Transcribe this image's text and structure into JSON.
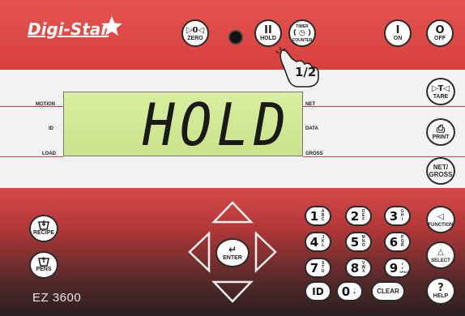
{
  "brand": {
    "logo": "Digi-Star"
  },
  "model": "EZ 3600",
  "display": {
    "text": "HOLD",
    "annotations_left": [
      "MOTION",
      "ID",
      "LOAD"
    ],
    "annotations_right": [
      "NET",
      "DATA",
      "GROSS"
    ]
  },
  "top_buttons": {
    "zero": {
      "symbol": "▷0◁",
      "label": "ZERO"
    },
    "hold": {
      "symbol": "II",
      "label": "HOLD"
    },
    "timer_top": "TIMER",
    "timer_symbol": "( ◷ )",
    "timer_bottom": "COUNTER",
    "on": {
      "symbol": "I",
      "label": "ON"
    },
    "off": {
      "symbol": "O",
      "label": "OFF"
    }
  },
  "hand_callout": "1/2",
  "right_buttons": {
    "tare": {
      "symbol": "▷T◁",
      "label": "TARE"
    },
    "print": {
      "symbol": "⎙",
      "label": "PRINT"
    },
    "net_gross": {
      "line1": "NET/",
      "line2": "GROSS"
    },
    "function": {
      "symbol": "◁",
      "label": "FUNCTION"
    },
    "select": {
      "symbol": "△",
      "label": "SELECT"
    },
    "help": {
      "symbol": "?",
      "label": "HELP"
    }
  },
  "left_buttons": {
    "recipe": {
      "label": "RECIPE"
    },
    "pens": {
      "label": "PENS"
    }
  },
  "nav": {
    "enter_label": "ENTER"
  },
  "keypad": [
    {
      "digit": "1",
      "sub": "A\nB\nC"
    },
    {
      "digit": "2",
      "sub": "D\nE\nF"
    },
    {
      "digit": "3",
      "sub": "G\nH\nI"
    },
    {
      "digit": "4",
      "sub": "J\nK\nL"
    },
    {
      "digit": "5",
      "sub": "M\nN\nO"
    },
    {
      "digit": "6",
      "sub": "P\nQ\nR"
    },
    {
      "digit": "7",
      "sub": "S\nT\nU"
    },
    {
      "digit": "8",
      "sub": "V\nW\nX"
    },
    {
      "digit": "9",
      "sub": "Y\nZ\nSPACE"
    },
    {
      "digit": "ID",
      "sub": ""
    },
    {
      "digit": "0",
      "sub": "-\n+"
    }
  ],
  "clear_label": "CLEAR",
  "colors": {
    "panel_red": "#d8403c",
    "lcd_green": "#c9e38a",
    "dark": "#2b1f22"
  }
}
